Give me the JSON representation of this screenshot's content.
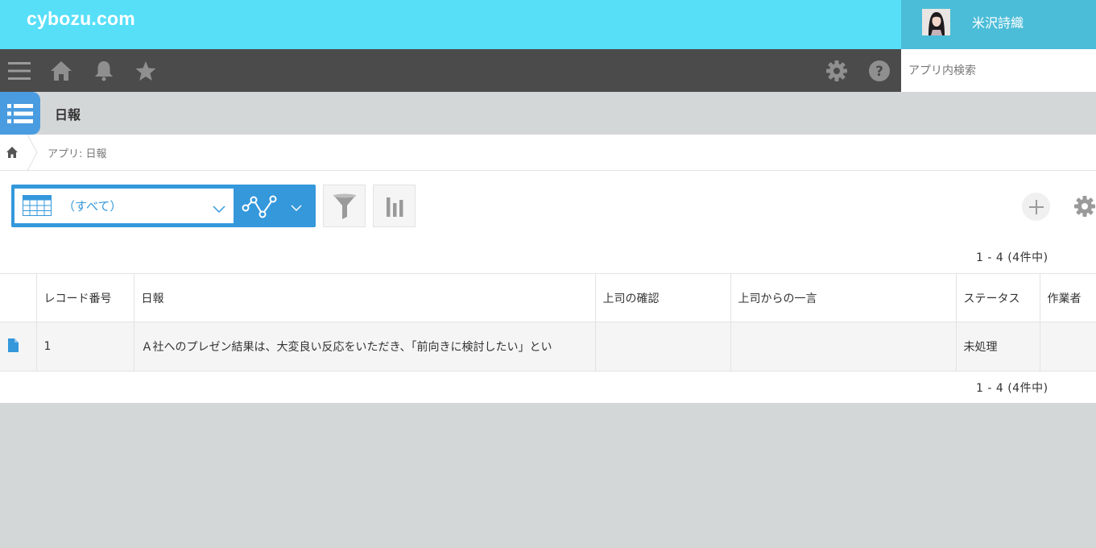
{
  "header": {
    "logo": "cybozu.com",
    "user_name": "米沢詩織"
  },
  "globalnav": {
    "icons": [
      "menu-icon",
      "home-icon",
      "bell-icon",
      "star-icon",
      "gear-icon",
      "help-icon"
    ],
    "search_placeholder": "アプリ内検索"
  },
  "app": {
    "title": "日報"
  },
  "breadcrumb": {
    "text": "アプリ: 日報"
  },
  "toolbar": {
    "view_label": "（すべて）"
  },
  "pager": {
    "top": "1 - 4  (4件中)",
    "bottom": "1 - 4  (4件中)"
  },
  "table": {
    "columns": [
      "",
      "レコード番号",
      "日報",
      "上司の確認",
      "上司からの一言",
      "ステータス",
      "作業者"
    ],
    "rows": [
      {
        "record_number": "1",
        "report": "Ａ社へのプレゼン結果は、大変良い反応をいただき、「前向きに検討したい」とい",
        "manager_check": "",
        "manager_comment": "",
        "status": "未処理",
        "assignee": ""
      }
    ]
  },
  "colors": {
    "header_bg": "#57dff8",
    "user_bg": "#4bbdd8",
    "nav_bg": "#4b4b4b",
    "accent": "#3498db"
  }
}
